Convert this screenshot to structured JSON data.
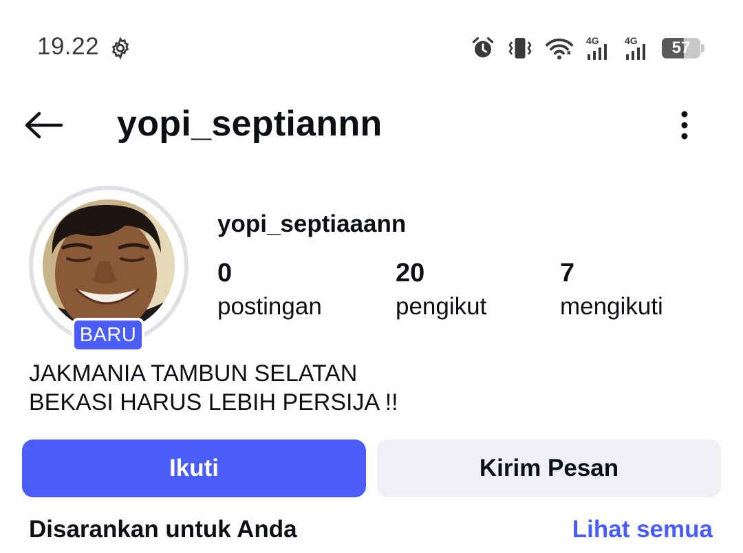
{
  "status_bar": {
    "time": "19.22",
    "network_1": "4G",
    "network_2": "4G",
    "battery_percent": "57",
    "battery_level": 0.57,
    "icons": [
      "gear-icon",
      "alarm-icon",
      "vibrate-icon",
      "wifi-icon",
      "signal-4g-icon",
      "signal-4g-icon",
      "battery-icon"
    ]
  },
  "header": {
    "username": "yopi_septiannn",
    "back_icon": "arrow-left-icon",
    "more_icon": "more-vertical-icon"
  },
  "profile": {
    "badge": "BARU",
    "display_name": "yopi_septiaaann",
    "stats": [
      {
        "value": "0",
        "label": "postingan"
      },
      {
        "value": "20",
        "label": "pengikut"
      },
      {
        "value": "7",
        "label": "mengikuti"
      }
    ],
    "bio": [
      "JAKMANIA TAMBUN SELATAN",
      "BEKASI HARUS LEBIH PERSIJA !!"
    ]
  },
  "actions": {
    "follow": "Ikuti",
    "message": "Kirim Pesan"
  },
  "suggestions": {
    "title": "Disarankan untuk Anda",
    "see_all": "Lihat semua"
  },
  "colors": {
    "accent": "#4a5df9",
    "secondary_button": "#eff0f4",
    "text": "#0c1014"
  }
}
